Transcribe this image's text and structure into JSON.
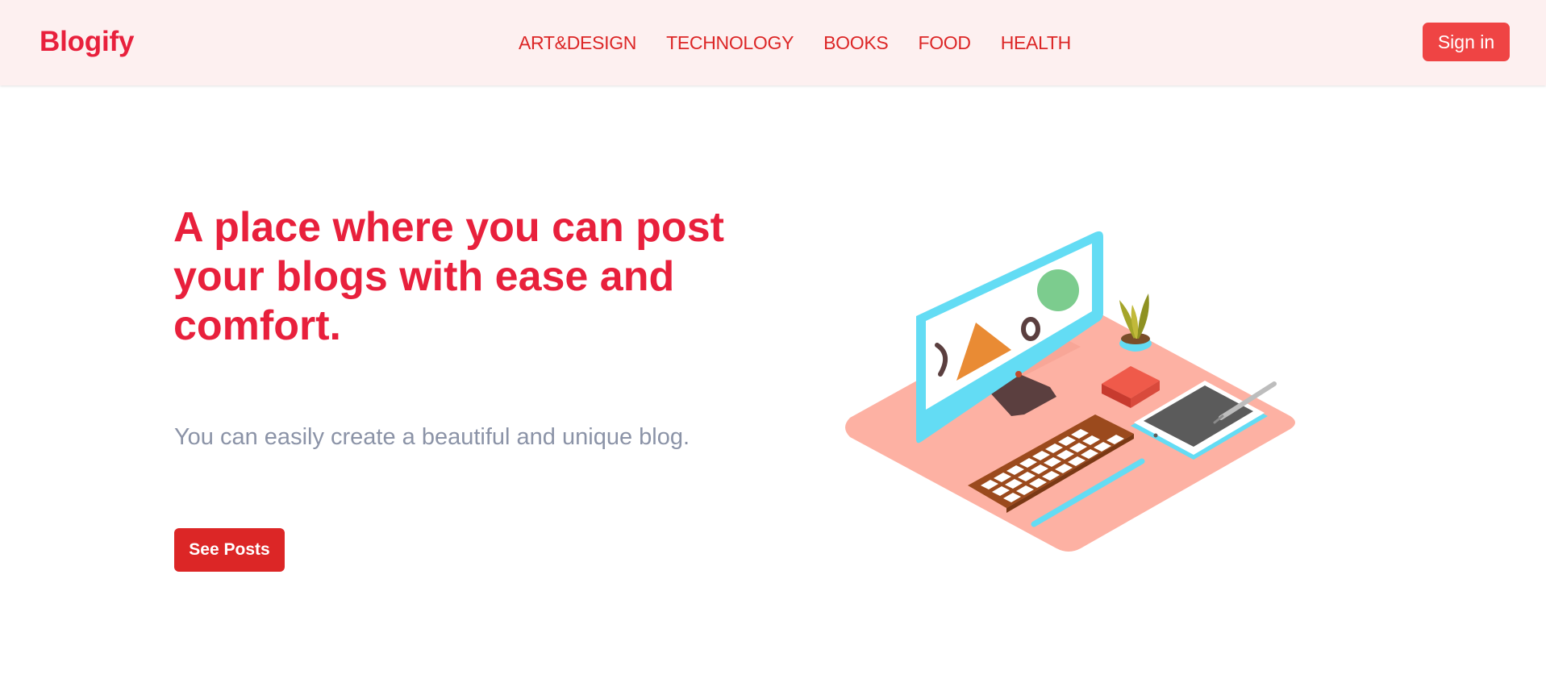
{
  "header": {
    "brand": "Blogify",
    "nav": [
      "ART&DESIGN",
      "TECHNOLOGY",
      "BOOKS",
      "FOOD",
      "HEALTH"
    ],
    "signin_label": "Sign in"
  },
  "hero": {
    "headline": "A place where you can post your blogs with ease and comfort.",
    "subtext": "You can easily create a beautiful and unique blog.",
    "cta_label": "See Posts"
  },
  "colors": {
    "brand": "#e8203c",
    "nav_text": "#dc2626",
    "button": "#ef4444",
    "header_bg": "#fdf0f0",
    "subtext": "#8b93a7"
  }
}
